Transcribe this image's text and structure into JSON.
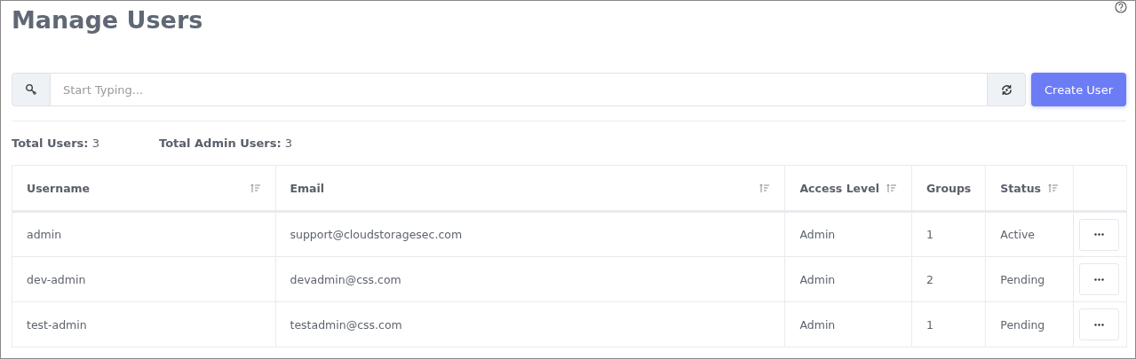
{
  "page": {
    "title": "Manage Users"
  },
  "search": {
    "placeholder": "Start Typing..."
  },
  "create_button": "Create User",
  "totals": [
    {
      "label": "Total Users:",
      "value": "3"
    },
    {
      "label": "Total Admin Users:",
      "value": "3"
    }
  ],
  "table": {
    "columns": [
      {
        "label": "Username",
        "sortable": true,
        "kind": "wide"
      },
      {
        "label": "Email",
        "sortable": true,
        "kind": "wide"
      },
      {
        "label": "Access Level",
        "sortable": true,
        "kind": "inline"
      },
      {
        "label": "Groups",
        "sortable": false,
        "kind": "inline"
      },
      {
        "label": "Status",
        "sortable": true,
        "kind": "inline"
      }
    ],
    "rows": [
      {
        "cells": [
          "admin",
          "support@cloudstoragesec.com",
          "Admin",
          "1",
          "Active"
        ]
      },
      {
        "cells": [
          "dev-admin",
          "devadmin@css.com",
          "Admin",
          "2",
          "Pending"
        ]
      },
      {
        "cells": [
          "test-admin",
          "testadmin@css.com",
          "Admin",
          "1",
          "Pending"
        ]
      }
    ]
  }
}
